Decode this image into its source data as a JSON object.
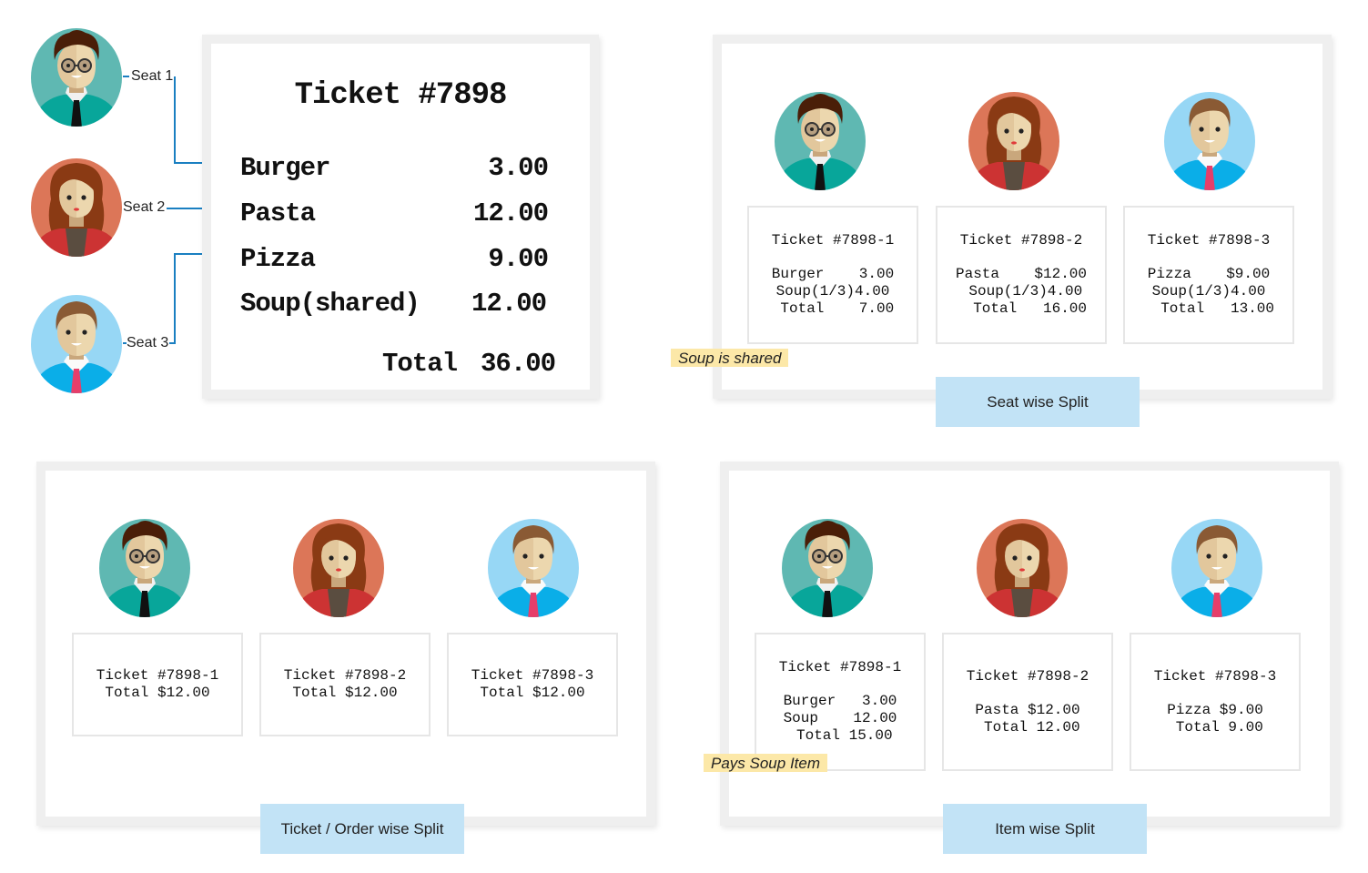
{
  "seats": [
    {
      "label": "Seat 1",
      "avatar": "man-curly-hair-glasses-teal-avatar"
    },
    {
      "label": "Seat 2",
      "avatar": "woman-red-hair-coral-avatar"
    },
    {
      "label": "Seat 3",
      "avatar": "man-brown-hair-lightblue-avatar"
    }
  ],
  "colors": {
    "arrow": "#1a7fc1",
    "label_box": "#c2e3f6",
    "note": "#fce8a8",
    "panel_border": "#efefef"
  },
  "receipt": {
    "title": "Ticket #7898",
    "items": [
      {
        "name": "Burger",
        "price": "3.00"
      },
      {
        "name": "Pasta",
        "price": "12.00"
      },
      {
        "name": "Pizza",
        "price": "9.00"
      },
      {
        "name": "Soup(shared)",
        "price": "12.00"
      }
    ],
    "total_label": "Total",
    "total_value": "36.00"
  },
  "seat_split": {
    "label": "Seat wise Split",
    "note": "Soup is shared",
    "tickets": [
      {
        "title": "Ticket #7898-1",
        "lines": [
          "Burger    3.00",
          "Soup(1/3)4.00",
          " Total    7.00"
        ]
      },
      {
        "title": "Ticket #7898-2",
        "lines": [
          "Pasta    $12.00",
          " Soup(1/3)4.00",
          "  Total   16.00"
        ]
      },
      {
        "title": "Ticket #7898-3",
        "lines": [
          "Pizza    $9.00",
          "Soup(1/3)4.00",
          "  Total   13.00"
        ]
      }
    ]
  },
  "order_split": {
    "label": "Ticket / Order  wise Split",
    "tickets": [
      {
        "title": "Ticket #7898-1",
        "lines": [
          "Total $12.00"
        ]
      },
      {
        "title": "Ticket #7898-2",
        "lines": [
          "Total $12.00"
        ]
      },
      {
        "title": "Ticket #7898-3",
        "lines": [
          "Total $12.00"
        ]
      }
    ]
  },
  "item_split": {
    "label": "Item wise Split",
    "note": "Pays Soup Item",
    "tickets": [
      {
        "title": "Ticket #7898-1",
        "lines": [
          "Burger   3.00",
          "Soup    12.00",
          " Total 15.00"
        ]
      },
      {
        "title": "Ticket #7898-2",
        "lines": [
          "Pasta $12.00",
          " Total 12.00"
        ]
      },
      {
        "title": "Ticket #7898-3",
        "lines": [
          "Pizza $9.00",
          " Total 9.00"
        ]
      }
    ]
  }
}
